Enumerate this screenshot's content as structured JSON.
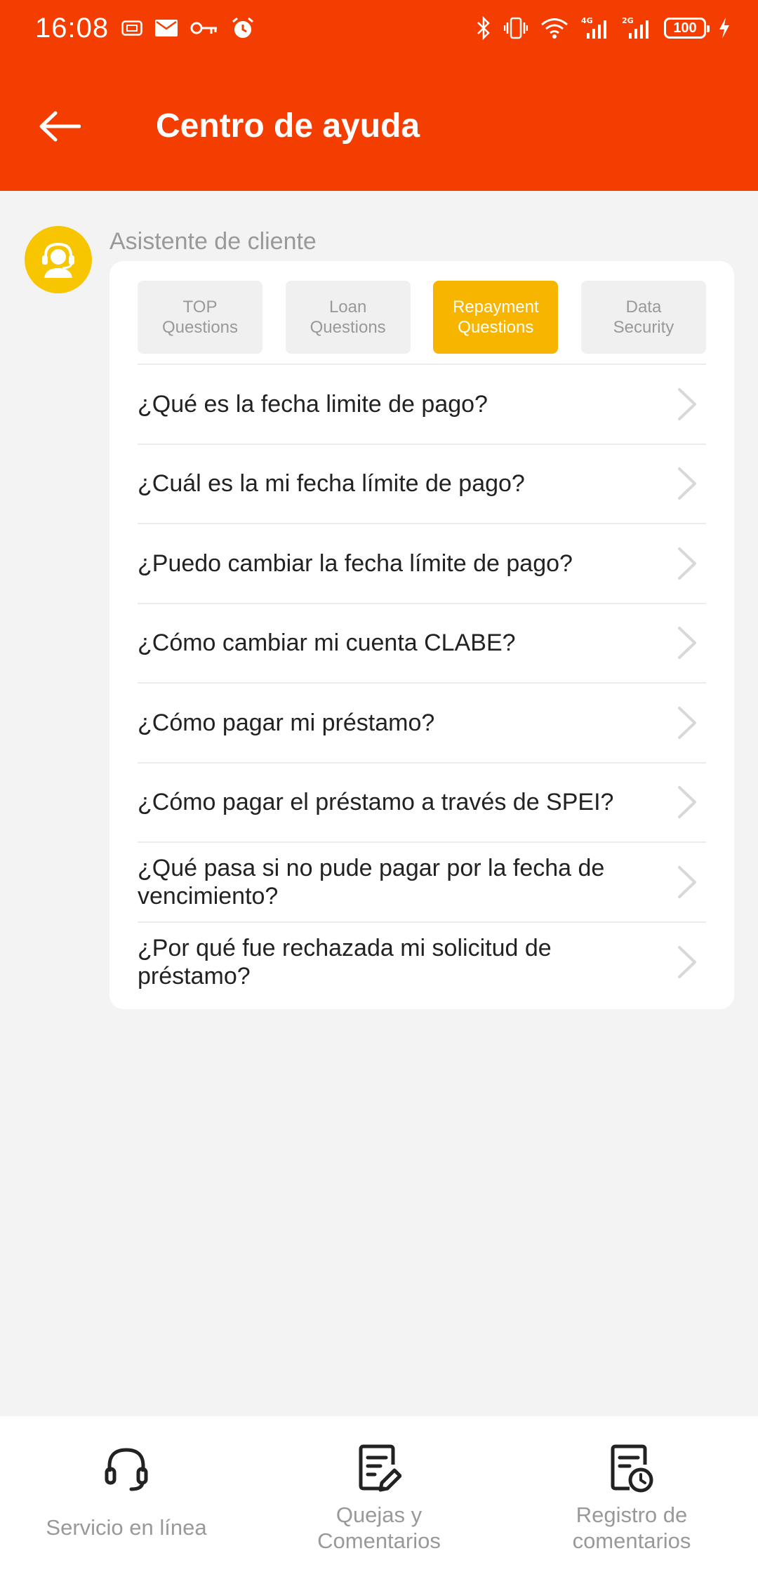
{
  "status_bar": {
    "time": "16:08",
    "battery": "100",
    "icons": [
      "sim-icon",
      "mail-icon",
      "key-icon",
      "alarm-icon",
      "bluetooth-icon",
      "vibrate-icon",
      "wifi-icon",
      "signal-4g-icon",
      "signal-2g-icon",
      "battery-icon",
      "charging-icon"
    ],
    "signal_label_1": "4G",
    "signal_label_2": "2G"
  },
  "header": {
    "title": "Centro de ayuda",
    "background_color": "#f43d00"
  },
  "assistant": {
    "name": "Asistente de cliente",
    "avatar_color": "#f7c600"
  },
  "tabs": [
    {
      "line1": "TOP",
      "line2": "Questions",
      "active": false
    },
    {
      "line1": "Loan",
      "line2": "Questions",
      "active": false
    },
    {
      "line1": "Repayment",
      "line2": "Questions",
      "active": true
    },
    {
      "line1": "Data",
      "line2": "Security",
      "active": false
    }
  ],
  "active_tab_color": "#f7b500",
  "questions": [
    "¿Qué es la fecha limite de pago?",
    "¿Cuál es la mi fecha límite de pago?",
    "¿Puedo cambiar la fecha límite de pago?",
    "¿Cómo cambiar mi cuenta CLABE?",
    "¿Cómo pagar mi préstamo?",
    "¿Cómo pagar el préstamo a través de SPEI?",
    "¿Qué pasa si no pude pagar por la fecha de vencimiento?",
    "¿Por qué fue rechazada mi solicitud de préstamo?"
  ],
  "bottom_nav": [
    {
      "label": "Servicio en línea",
      "icon": "headset-icon"
    },
    {
      "label": "Quejas y\nComentarios",
      "icon": "edit-document-icon"
    },
    {
      "label": "Registro de\ncomentarios",
      "icon": "document-clock-icon"
    }
  ]
}
